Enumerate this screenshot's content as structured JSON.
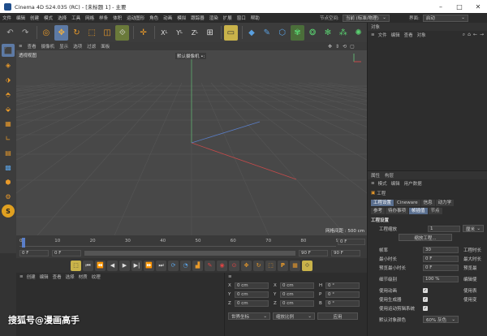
{
  "title": "Cinema 4D S24.035 (RC) - [未标题 1] - 主要",
  "menu": [
    "文件",
    "编辑",
    "创建",
    "模式",
    "选择",
    "工具",
    "网格",
    "样条",
    "体积",
    "运动图形",
    "角色",
    "动画",
    "模拟",
    "跟踪器",
    "渲染",
    "扩展",
    "窗口",
    "帮助"
  ],
  "menu_right": {
    "node_space_label": "节点空间:",
    "node_space_value": "当前 (标准/物理)",
    "interface_label": "界面:",
    "interface_value": "启动"
  },
  "toolbar_icons": [
    "undo-icon",
    "redo-icon",
    "select-icon",
    "move-icon",
    "rotate-icon",
    "scale-icon",
    "object-tool-icon",
    "last-tool-icon",
    "x-axis-icon",
    "y-axis-icon",
    "z-axis-icon",
    "coordinate-icon",
    "render-view-icon",
    "cube-icon",
    "spline-pen-icon",
    "subdivision-icon",
    "cloner-icon",
    "deformer-icon",
    "scene-icon",
    "camera-icon",
    "light-icon"
  ],
  "viewport_menu": [
    "查看",
    "摄像机",
    "显示",
    "选项",
    "过滤",
    "面板"
  ],
  "viewport": {
    "label": "透视视图",
    "camera": "默认摄像机",
    "camera_mark": "•:",
    "grid": "网格间距 : 500 cm"
  },
  "timeline": {
    "ticks": [
      "0",
      "10",
      "20",
      "30",
      "40",
      "50",
      "60",
      "70",
      "80",
      "90"
    ],
    "frame_right": "0 F",
    "start": "0 F",
    "start2": "0 F",
    "end": "90 F",
    "end2": "90 F"
  },
  "transport_icons": [
    "record-icon",
    "first-frame-icon",
    "prev-key-icon",
    "prev-frame-icon",
    "play-icon",
    "next-frame-icon",
    "next-key-icon",
    "last-frame-icon",
    "loop-icon",
    "timeline-icon",
    "key-record-icon",
    "auto-key-icon",
    "key-icon",
    "pos-key-icon",
    "rot-key-icon",
    "scale-key-icon",
    "param-key-icon",
    "pla-key-icon"
  ],
  "bottom_menu": [
    "创建",
    "编辑",
    "查看",
    "选择",
    "材质",
    "纹理"
  ],
  "coords": {
    "rows": [
      {
        "a": "X",
        "av": "0 cm",
        "b": "X",
        "bv": "0 cm",
        "c": "H",
        "cv": "0 °"
      },
      {
        "a": "Y",
        "av": "0 cm",
        "b": "Y",
        "bv": "0 cm",
        "c": "P",
        "cv": "0 °"
      },
      {
        "a": "Z",
        "av": "0 cm",
        "b": "Z",
        "bv": "0 cm",
        "c": "B",
        "cv": "0 °"
      }
    ],
    "mode1": "世界坐标",
    "mode2": "缩放比例",
    "apply": "应用"
  },
  "objects_panel": {
    "title": "对象",
    "menu": [
      "文件",
      "编辑",
      "查看",
      "对象"
    ]
  },
  "attrs": {
    "tabs": [
      "属性",
      "构层"
    ],
    "menu": [
      "模式",
      "编辑",
      "用户数据"
    ],
    "section": "工程",
    "tabs_row1": [
      "工程设置",
      "Cineware",
      "信息",
      "动力学"
    ],
    "tabs_row2": [
      "参考",
      "待办事项",
      "帧插值",
      "节点"
    ],
    "settings_title": "工程设置",
    "scale_label": "工程缩放",
    "scale_value": "1",
    "scale_unit": "厘米",
    "scale_btn": "缩放工程...",
    "fps_label": "帧率",
    "fps_value": "30",
    "time_label": "工程时长",
    "min_label": "最小时长",
    "min_value": "0 F",
    "max_label": "最大时长",
    "pmin_label": "预览最小时长",
    "pmin_value": "0 F",
    "pmax_label": "预览最",
    "lod_label": "细节级别",
    "lod_value": "100 %",
    "lod_right": "编辑使",
    "use_anim": "使用动画",
    "use_anim_r": "使用表",
    "use_gen": "使用生成器",
    "use_gen_r": "使用变",
    "use_motion": "使用运动剪辑系统",
    "default_color_label": "默认对象颜色",
    "default_color_value": "60% 灰色"
  },
  "watermark": "搜狐号@漫画高手",
  "colors": {
    "selected": "#5d7aa5",
    "viewport": "#484848",
    "panel": "#2d2d2d"
  }
}
